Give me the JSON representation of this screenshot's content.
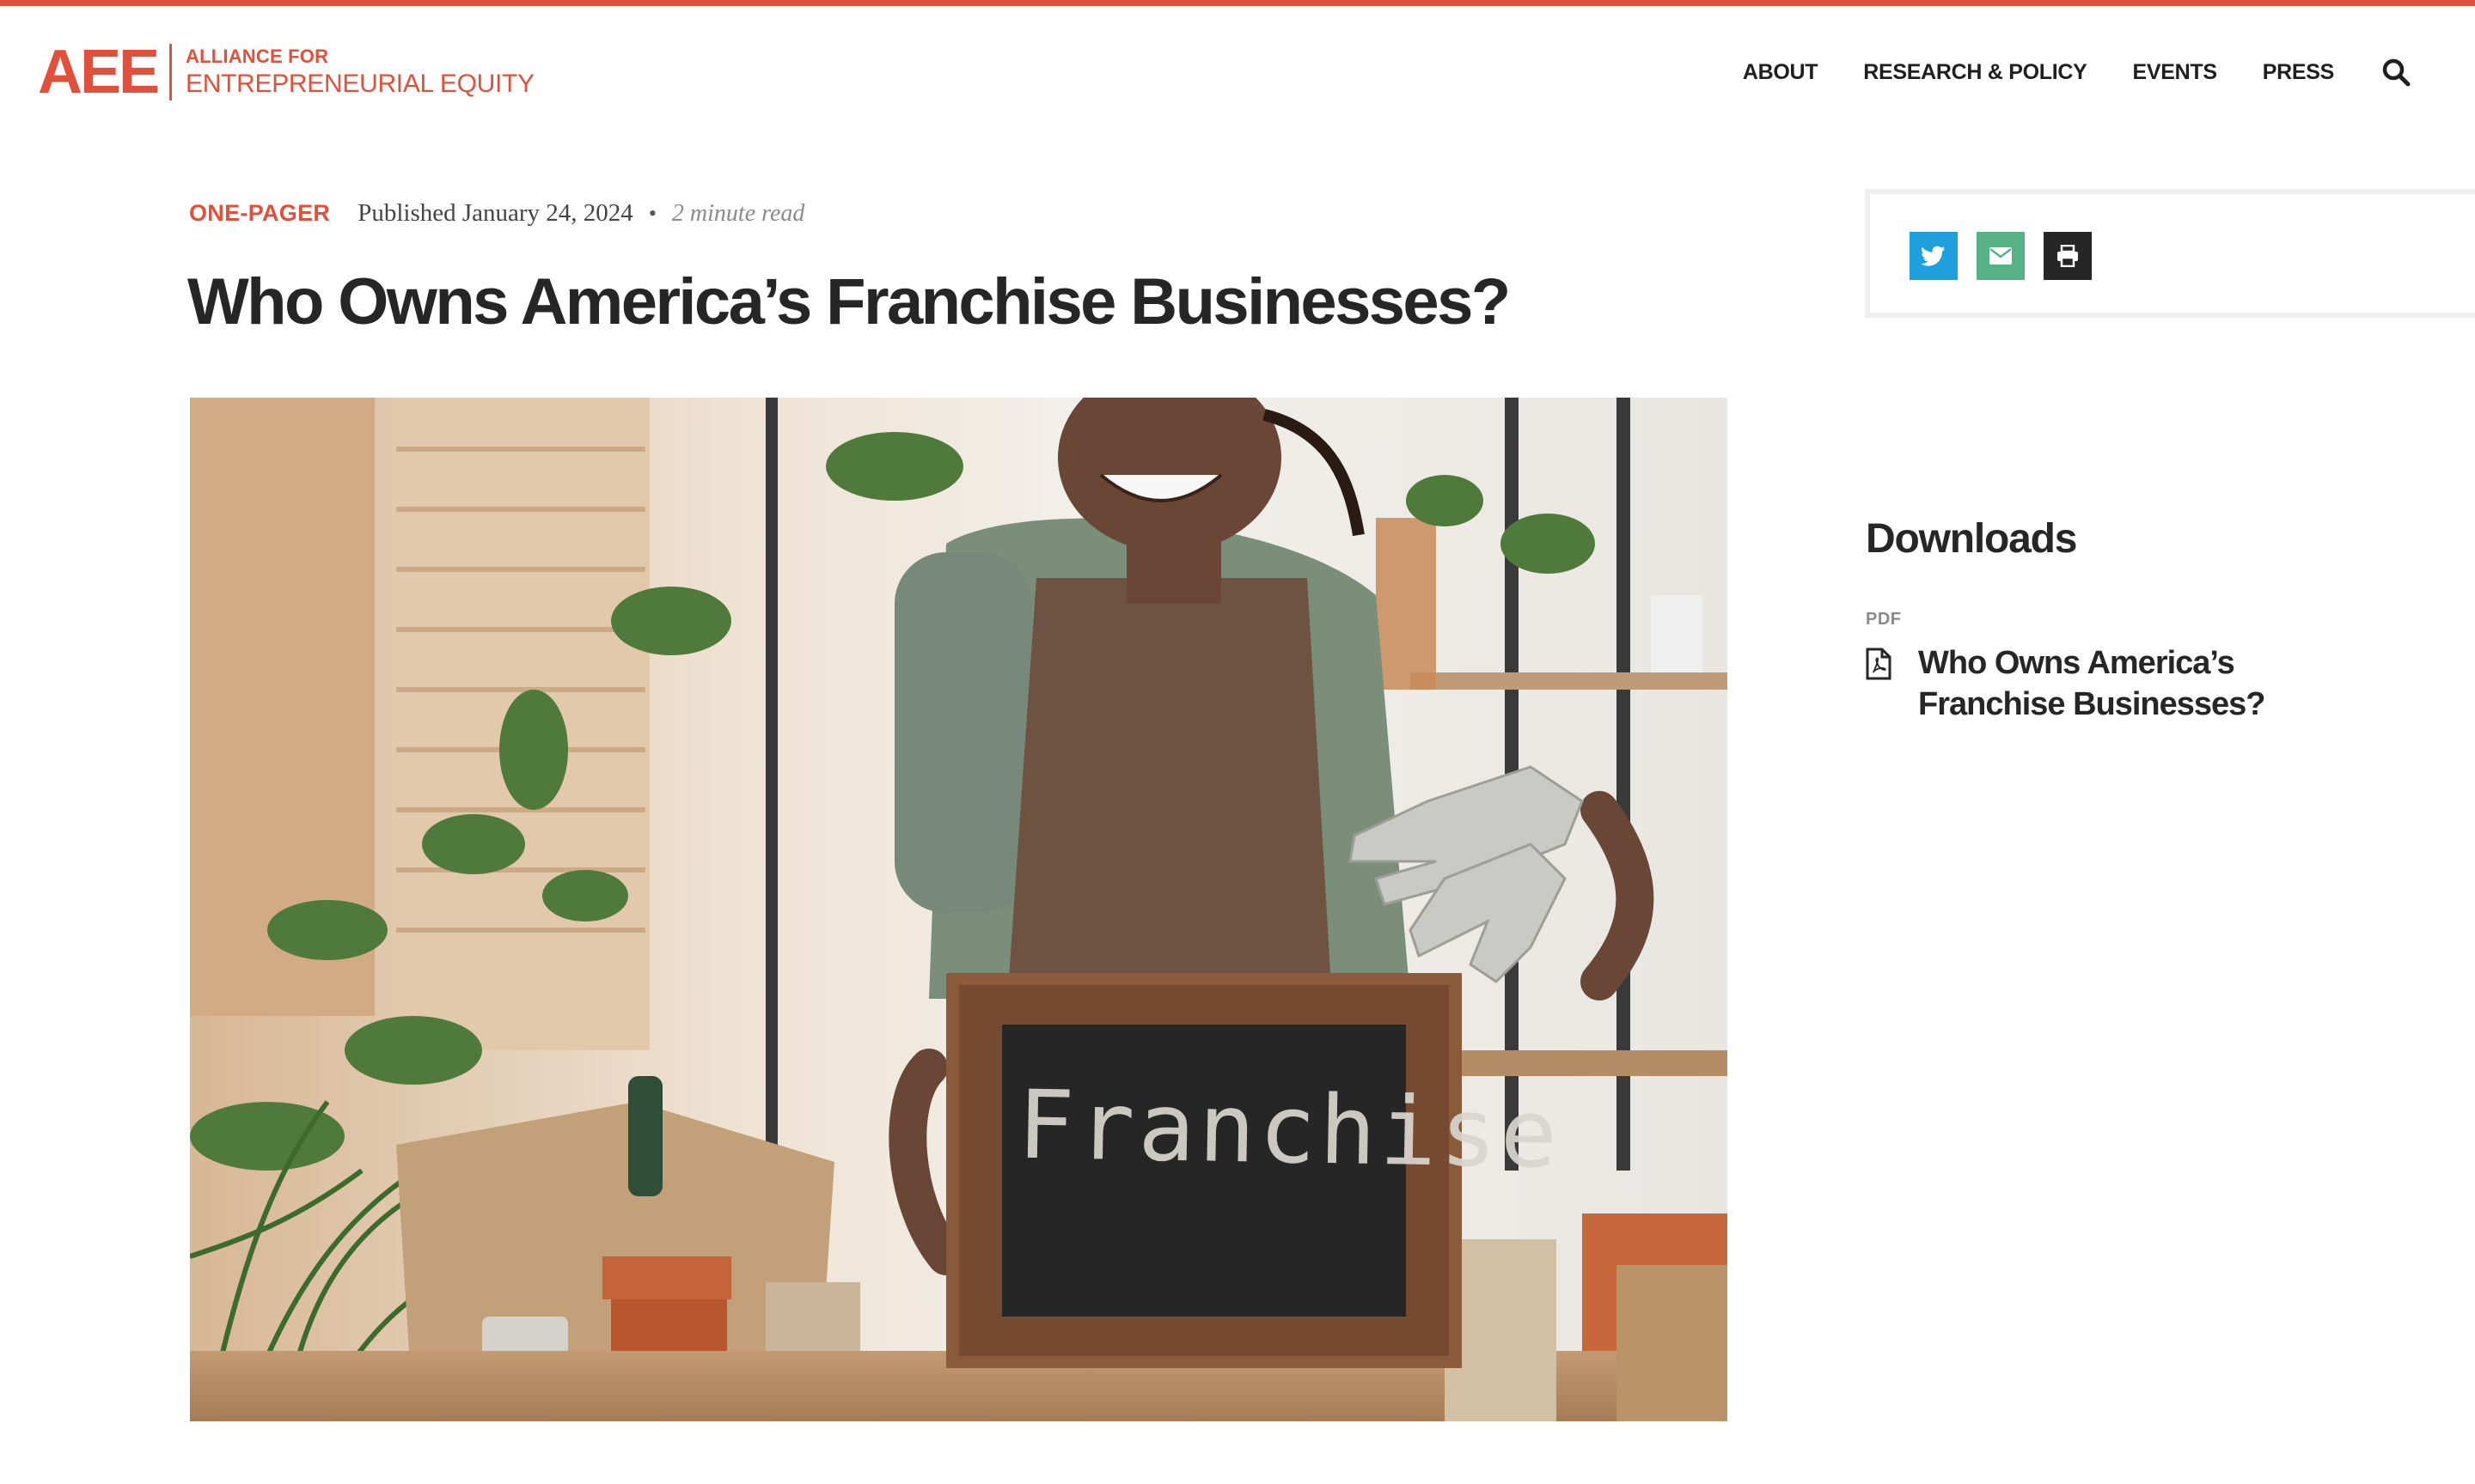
{
  "brand": {
    "logo_letters": "AEE",
    "line1": "ALLIANCE FOR",
    "line2": "ENTREPRENEURIAL EQUITY",
    "accent_color": "#e1503a"
  },
  "nav": {
    "items": [
      {
        "label": "ABOUT"
      },
      {
        "label": "RESEARCH & POLICY"
      },
      {
        "label": "EVENTS"
      },
      {
        "label": "PRESS"
      }
    ],
    "search_icon": "search-icon"
  },
  "article": {
    "category": "ONE-PAGER",
    "published": "Published January 24, 2024",
    "separator": "•",
    "read_time": "2 minute read",
    "title": "Who Owns America’s Franchise Businesses?",
    "hero_image": {
      "description_icon": "photo",
      "chalkboard_text": "Franchise"
    }
  },
  "share": {
    "buttons": [
      {
        "icon": "twitter-icon",
        "color": "#1da0db"
      },
      {
        "icon": "email-icon",
        "color": "#56b285"
      },
      {
        "icon": "print-icon",
        "color": "#262626"
      }
    ]
  },
  "downloads": {
    "heading": "Downloads",
    "items": [
      {
        "type": "PDF",
        "title": "Who Owns America’s Franchise Businesses?",
        "icon": "pdf-file-icon"
      }
    ]
  }
}
